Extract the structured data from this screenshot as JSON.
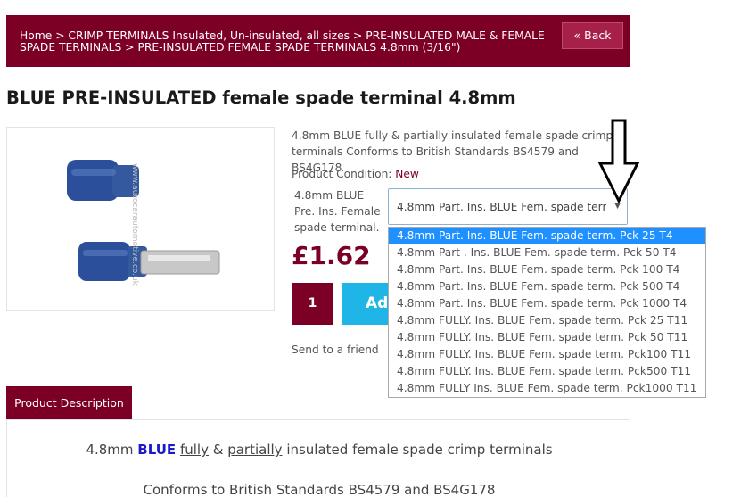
{
  "breadcrumb": {
    "text": "Home > CRIMP TERMINALS Insulated, Un-insulated, all sizes > PRE-INSULATED MALE & FEMALE SPADE TERMINALS > PRE-INSULATED FEMALE SPADE TERMINALS 4.8mm (3/16\")",
    "back_label": "« Back"
  },
  "product": {
    "title": "BLUE PRE-INSULATED female spade terminal 4.8mm",
    "short_description": "4.8mm BLUE fully & partially insulated female spade crimp terminals Conforms to British Standards BS4579 and BS4G178",
    "condition_label": "Product Condition:",
    "condition_value": "New",
    "option_label": "4.8mm BLUE Pre. Ins. Female spade terminal.",
    "selected_option": "4.8mm Part. Ins. BLUE Fem. spade term. Pck 25 T4",
    "price": "£1.62",
    "quantity": "1",
    "add_label": "Add to cart",
    "send_label": "Send to a friend",
    "image_watermark": "www.autocarautomotive.co.uk"
  },
  "dropdown": {
    "options": [
      "4.8mm Part. Ins. BLUE Fem. spade term. Pck 25 T4",
      "4.8mm Part . Ins. BLUE Fem. spade term. Pck 50 T4",
      "4.8mm Part. Ins. BLUE Fem. spade term. Pck 100 T4",
      "4.8mm Part. Ins. BLUE Fem. spade term. Pck 500 T4",
      "4.8mm Part. Ins. BLUE Fem. spade term. Pck 1000 T4",
      "4.8mm FULLY. Ins. BLUE Fem. spade term. Pck 25 T11",
      "4.8mm FULLY. Ins. BLUE Fem. spade term. Pck 50 T11",
      "4.8mm FULLY. Ins. BLUE Fem. spade term. Pck100 T11",
      "4.8mm FULLY. Ins. BLUE Fem. spade term. Pck500 T11",
      "4.8mm FULLY Ins. BLUE Fem. spade term. Pck1000 T11"
    ],
    "selected_index": 0
  },
  "description_tab": {
    "label": "Product Description",
    "line1_prefix": "4.8mm ",
    "line1_blue": "BLUE",
    "line1_fully": "fully",
    "line1_amp": " & ",
    "line1_partially": "partially",
    "line1_suffix": " insulated female spade crimp terminals",
    "line2": "Conforms to British Standards BS4579 and BS4G178"
  },
  "colors": {
    "brand": "#7c0025",
    "accent_blue": "#1fb5e6",
    "dropdown_selected": "#1e90ff"
  }
}
